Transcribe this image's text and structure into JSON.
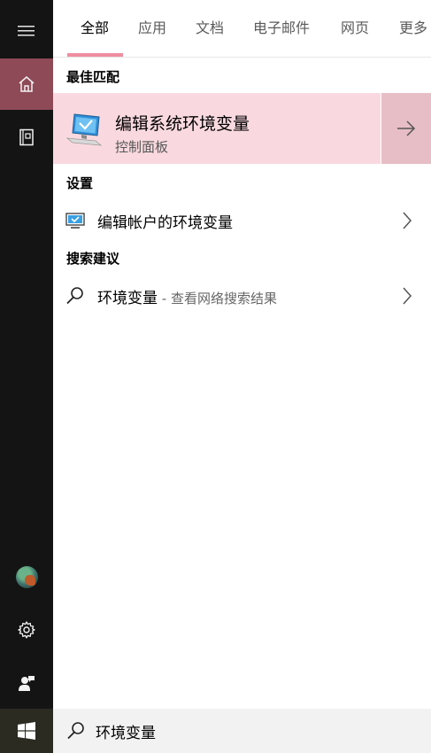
{
  "tabs": [
    {
      "label": "全部",
      "active": true
    },
    {
      "label": "应用"
    },
    {
      "label": "文档"
    },
    {
      "label": "电子邮件"
    },
    {
      "label": "网页"
    },
    {
      "label": "更多"
    }
  ],
  "sections": {
    "best_match": "最佳匹配",
    "settings": "设置",
    "suggestions": "搜索建议"
  },
  "best_match": {
    "title": "编辑系统环境变量",
    "subtitle": "控制面板"
  },
  "settings_item": {
    "label": "编辑帐户的环境变量"
  },
  "suggestion_item": {
    "label": "环境变量",
    "suffix": " - 查看网络搜索结果"
  },
  "search": {
    "value": "环境变量"
  },
  "colors": {
    "accent": "#ef8ea0",
    "best_bg": "#f9d9df",
    "rail_bg": "#141414",
    "rail_active": "#8e4a57"
  },
  "icons": [
    "hamburger-icon",
    "home-icon",
    "notebook-icon",
    "avatar",
    "gear-icon",
    "feedback-icon",
    "windows-logo-icon",
    "monitor-icon",
    "arrow-right-icon",
    "chevron-right-icon",
    "search-icon"
  ]
}
